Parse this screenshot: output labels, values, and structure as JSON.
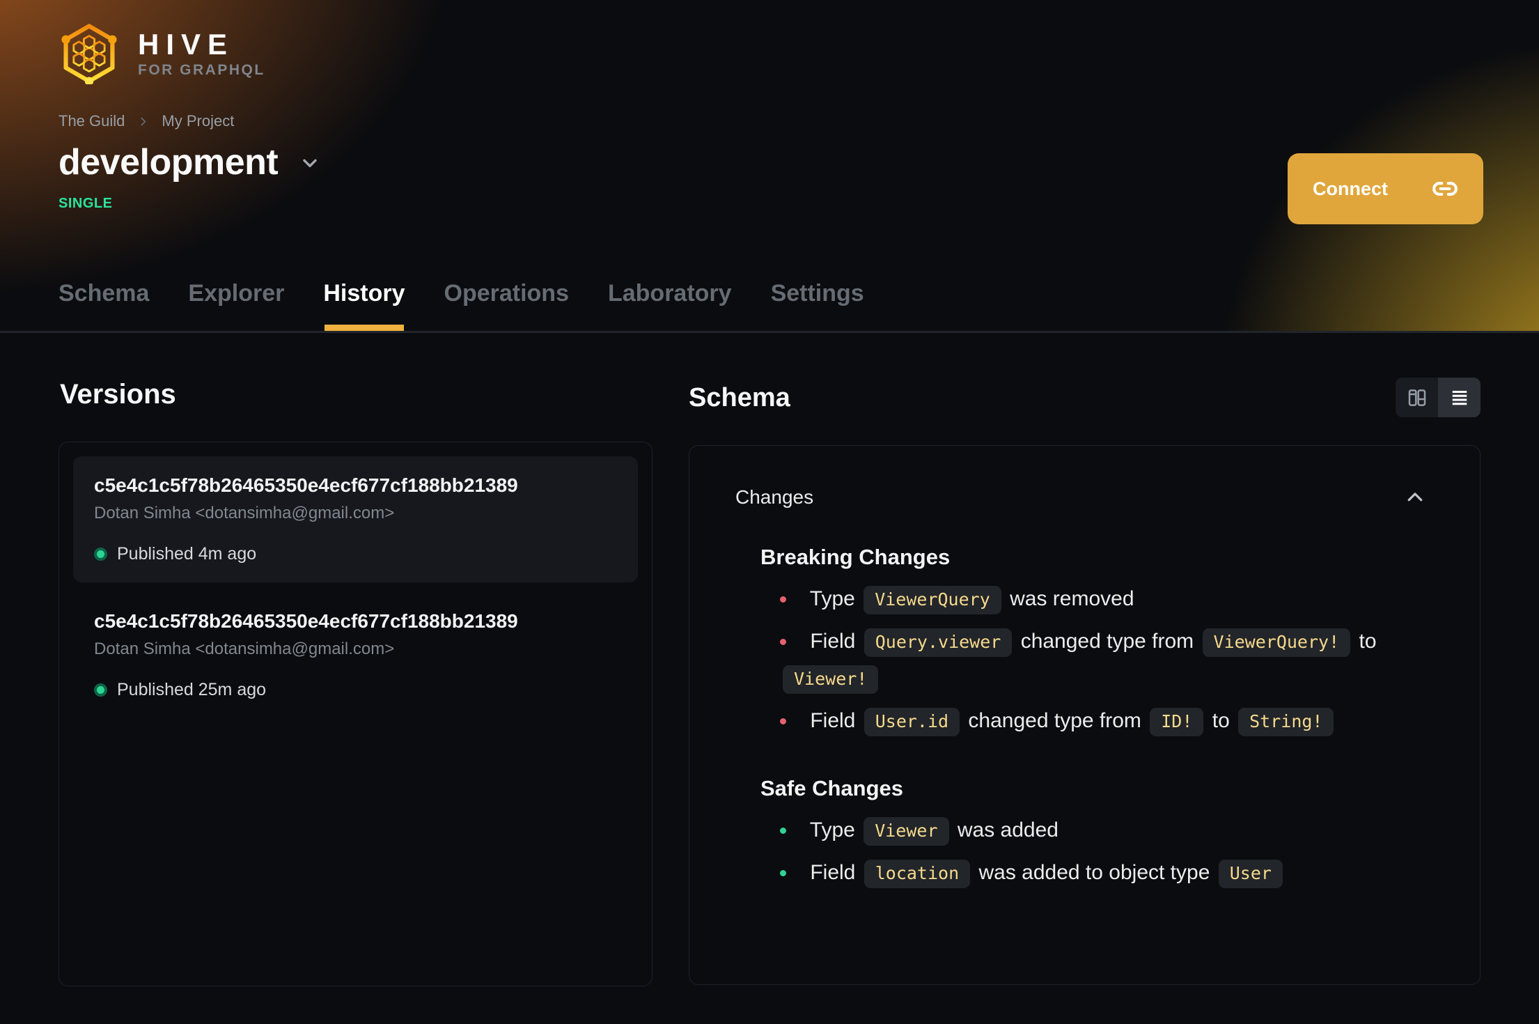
{
  "brand": {
    "name": "HIVE",
    "tagline": "FOR GRAPHQL"
  },
  "breadcrumb": {
    "org": "The Guild",
    "project": "My Project"
  },
  "page": {
    "title": "development",
    "badge": "SINGLE"
  },
  "toolbar": {
    "connect_label": "Connect"
  },
  "tabs": [
    {
      "label": "Schema"
    },
    {
      "label": "Explorer"
    },
    {
      "label": "History"
    },
    {
      "label": "Operations"
    },
    {
      "label": "Laboratory"
    },
    {
      "label": "Settings"
    }
  ],
  "active_tab": "History",
  "versions": {
    "title": "Versions",
    "items": [
      {
        "hash": "c5e4c1c5f78b26465350e4ecf677cf188bb21389",
        "author": "Dotan Simha <dotansimha@gmail.com>",
        "status": "Published 4m ago",
        "selected": true
      },
      {
        "hash": "c5e4c1c5f78b26465350e4ecf677cf188bb21389",
        "author": "Dotan Simha <dotansimha@gmail.com>",
        "status": "Published 25m ago",
        "selected": false
      }
    ]
  },
  "schema": {
    "title": "Schema",
    "changes_header": "Changes",
    "breaking": {
      "title": "Breaking Changes",
      "items": [
        {
          "t1": "Type",
          "c1": "ViewerQuery",
          "t2": "was removed"
        },
        {
          "t1": "Field",
          "c1": "Query.viewer",
          "t2": "changed type from",
          "c2": "ViewerQuery!",
          "t3": "to",
          "c3": "Viewer!"
        },
        {
          "t1": "Field",
          "c1": "User.id",
          "t2": "changed type from",
          "c2": "ID!",
          "t3": "to",
          "c3": "String!"
        }
      ]
    },
    "safe": {
      "title": "Safe Changes",
      "items": [
        {
          "t1": "Type",
          "c1": "Viewer",
          "t2": "was added"
        },
        {
          "t1": "Field",
          "c1": "location",
          "t2": "was added to object type",
          "c2": "User"
        }
      ]
    }
  },
  "colors": {
    "accent_yellow": "#e0a63c",
    "tab_underline": "#efb13f",
    "badge_green": "#2be39d",
    "breaking_bullet": "#e4626e",
    "safe_bullet": "#2fd394",
    "chip_text": "#f5d98d",
    "published_dot": "#2dd594"
  }
}
